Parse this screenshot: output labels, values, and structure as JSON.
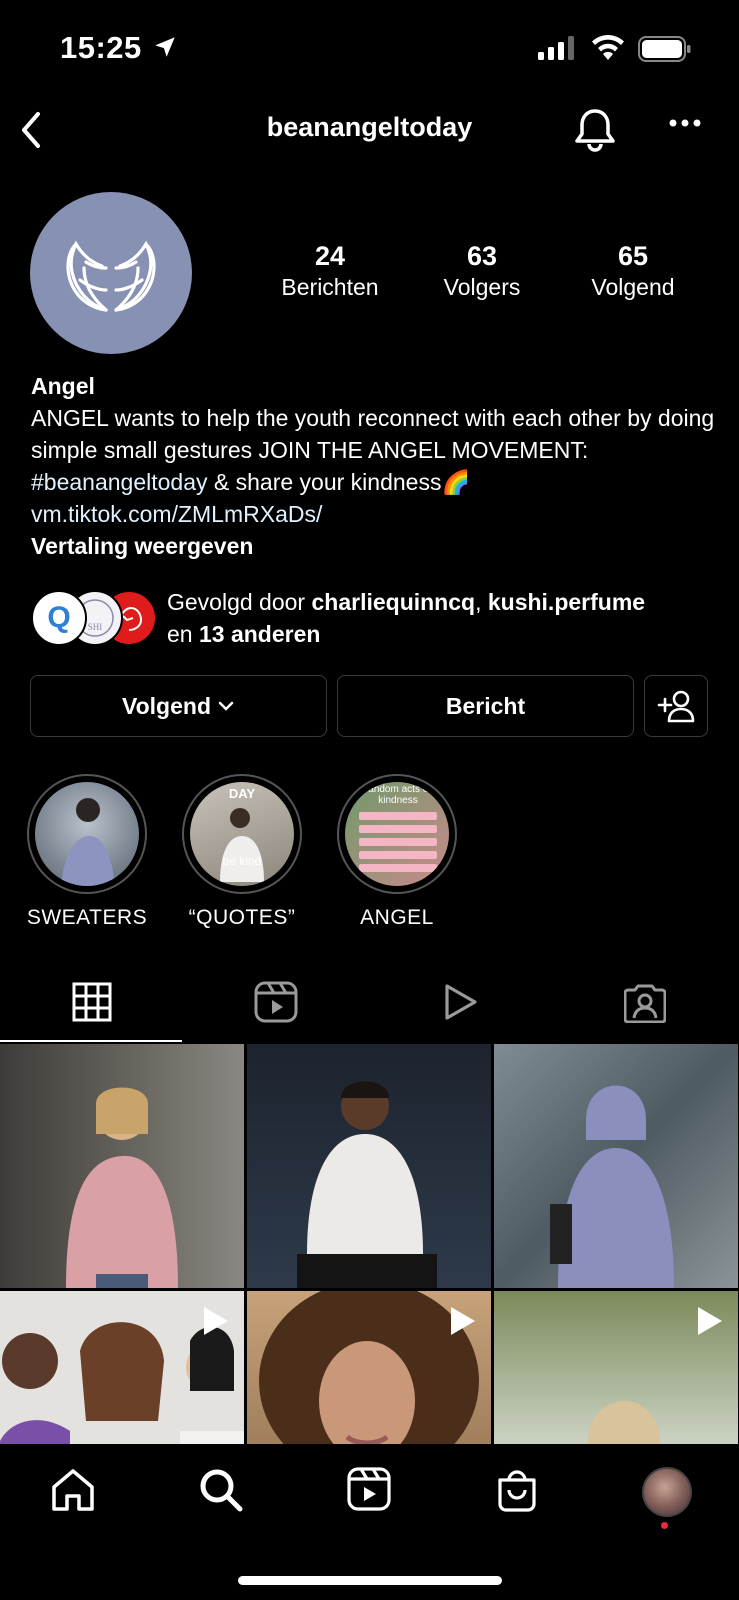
{
  "status_bar": {
    "time": "15:25",
    "icons": [
      "location-arrow-icon",
      "cellular-signal-icon",
      "wifi-icon",
      "battery-icon"
    ]
  },
  "header": {
    "username": "beanangeltoday",
    "icons": [
      "back-chevron-icon",
      "bell-icon",
      "more-dots-icon"
    ]
  },
  "profile": {
    "stats": [
      {
        "value": "24",
        "label": "Berichten"
      },
      {
        "value": "63",
        "label": "Volgers"
      },
      {
        "value": "65",
        "label": "Volgend"
      }
    ],
    "name": "Angel",
    "bio_1": "ANGEL wants to help the youth reconnect with each other by doing simple small gestures JOIN THE ANGEL MOVEMENT: ",
    "hashtag": "#beanangeltoday",
    "bio_2": " & share your kindness",
    "emoji": "🌈",
    "link": "vm.tiktok.com/ZMLmRXaDs/",
    "translate": "Vertaling weergeven"
  },
  "followed_by": {
    "prefix": "Gevolgd door ",
    "user1": "charliequinncq",
    "sep": ", ",
    "user2": "kushi.perfume",
    "mid": " en ",
    "others": "13 anderen",
    "favicon_q": "Q"
  },
  "buttons": {
    "following": "Volgend",
    "message": "Bericht"
  },
  "highlights": [
    {
      "label": "SWEATERS"
    },
    {
      "label": "“QUOTES”",
      "overlay_top": "DAY",
      "overlay_text": "be kind"
    },
    {
      "label": "ANGEL",
      "overlay_top": "random acts of kindness"
    }
  ],
  "tabs": [
    "grid-icon",
    "reels-icon",
    "video-play-icon",
    "tagged-person-icon"
  ],
  "nav": [
    "home-icon",
    "search-icon",
    "reels-icon",
    "shop-bag-icon",
    "profile-avatar"
  ],
  "colors": {
    "background": "#000000",
    "avatar_bg": "#8791b4",
    "link": "#e0f1ff",
    "notification_dot": "#ed2a3d"
  }
}
